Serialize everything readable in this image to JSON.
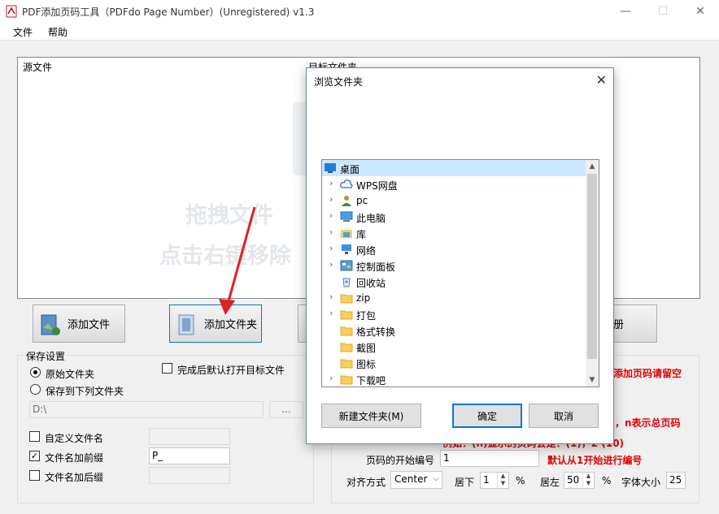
{
  "window": {
    "title": "PDF添加页码工具（PDFdo Page Number）(Unregistered) v1.3",
    "minimize_glyph": "—",
    "maximize_glyph": "☐",
    "close_glyph": "✕"
  },
  "menu": {
    "file": "文件",
    "help": "帮助"
  },
  "filelist": {
    "col_source": "源文件",
    "col_target": "目标文件夹",
    "hint_line1": "拖拽文件",
    "hint_line2": "点击右键移除"
  },
  "toolbar": {
    "add_file": "添加文件",
    "add_folder": "添加文件夹",
    "register_partial": "册"
  },
  "save": {
    "group_title": "保存设置",
    "original_folder": "原始文件夹",
    "save_to_folder": "保存到下列文件夹",
    "path": "D:\\",
    "browse": "...",
    "open_after": "完成后默认打开目标文件",
    "custom_name": "自定义文件名",
    "prefix": "文件名加前缀",
    "prefix_value": "P_",
    "suffix": "文件名加后缀"
  },
  "page": {
    "note_top": "添加页码请留空",
    "note_n": "，n表示总页码",
    "note_example": "例如：(n)显示的页码会是：(1)，2 (10)",
    "start_label": "页码的开始编号",
    "start_value": "1",
    "start_note": "默认从1开始进行编号",
    "align_label": "对齐方式",
    "align_value": "Center",
    "bottom_label": "居下",
    "bottom_value": "1",
    "bottom_unit": "%",
    "left_label": "居左",
    "left_value": "50",
    "left_unit": "%",
    "font_label": "字体大小",
    "font_value": "25"
  },
  "dialog": {
    "title": "浏览文件夹",
    "close_glyph": "✕",
    "tree": [
      {
        "label": "桌面",
        "expander": "",
        "icon": "desktop-icon",
        "level": 0,
        "selected": true
      },
      {
        "label": "WPS网盘",
        "expander": "›",
        "icon": "cloud-icon",
        "level": 1
      },
      {
        "label": "pc",
        "expander": "›",
        "icon": "user-icon",
        "level": 1
      },
      {
        "label": "此电脑",
        "expander": "›",
        "icon": "computer-icon",
        "level": 1
      },
      {
        "label": "库",
        "expander": "›",
        "icon": "library-icon",
        "level": 1
      },
      {
        "label": "网络",
        "expander": "›",
        "icon": "network-icon",
        "level": 1
      },
      {
        "label": "控制面板",
        "expander": "›",
        "icon": "control-panel-icon",
        "level": 1
      },
      {
        "label": "回收站",
        "expander": "",
        "icon": "recycle-bin-icon",
        "level": 1
      },
      {
        "label": "zip",
        "expander": "›",
        "icon": "folder-icon",
        "level": 1
      },
      {
        "label": "打包",
        "expander": "›",
        "icon": "folder-icon",
        "level": 1
      },
      {
        "label": "格式转换",
        "expander": "",
        "icon": "folder-icon",
        "level": 1
      },
      {
        "label": "截图",
        "expander": "",
        "icon": "folder-icon",
        "level": 1
      },
      {
        "label": "图标",
        "expander": "",
        "icon": "folder-icon",
        "level": 1
      },
      {
        "label": "下载吧",
        "expander": "›",
        "icon": "folder-icon",
        "level": 1
      }
    ],
    "new_folder": "新建文件夹(M)",
    "ok": "确定",
    "cancel": "取消"
  },
  "colors": {
    "accent": "#0078d7",
    "red_note": "#e00000",
    "selection": "#cce8ff",
    "folder": "#f7cf5b"
  }
}
